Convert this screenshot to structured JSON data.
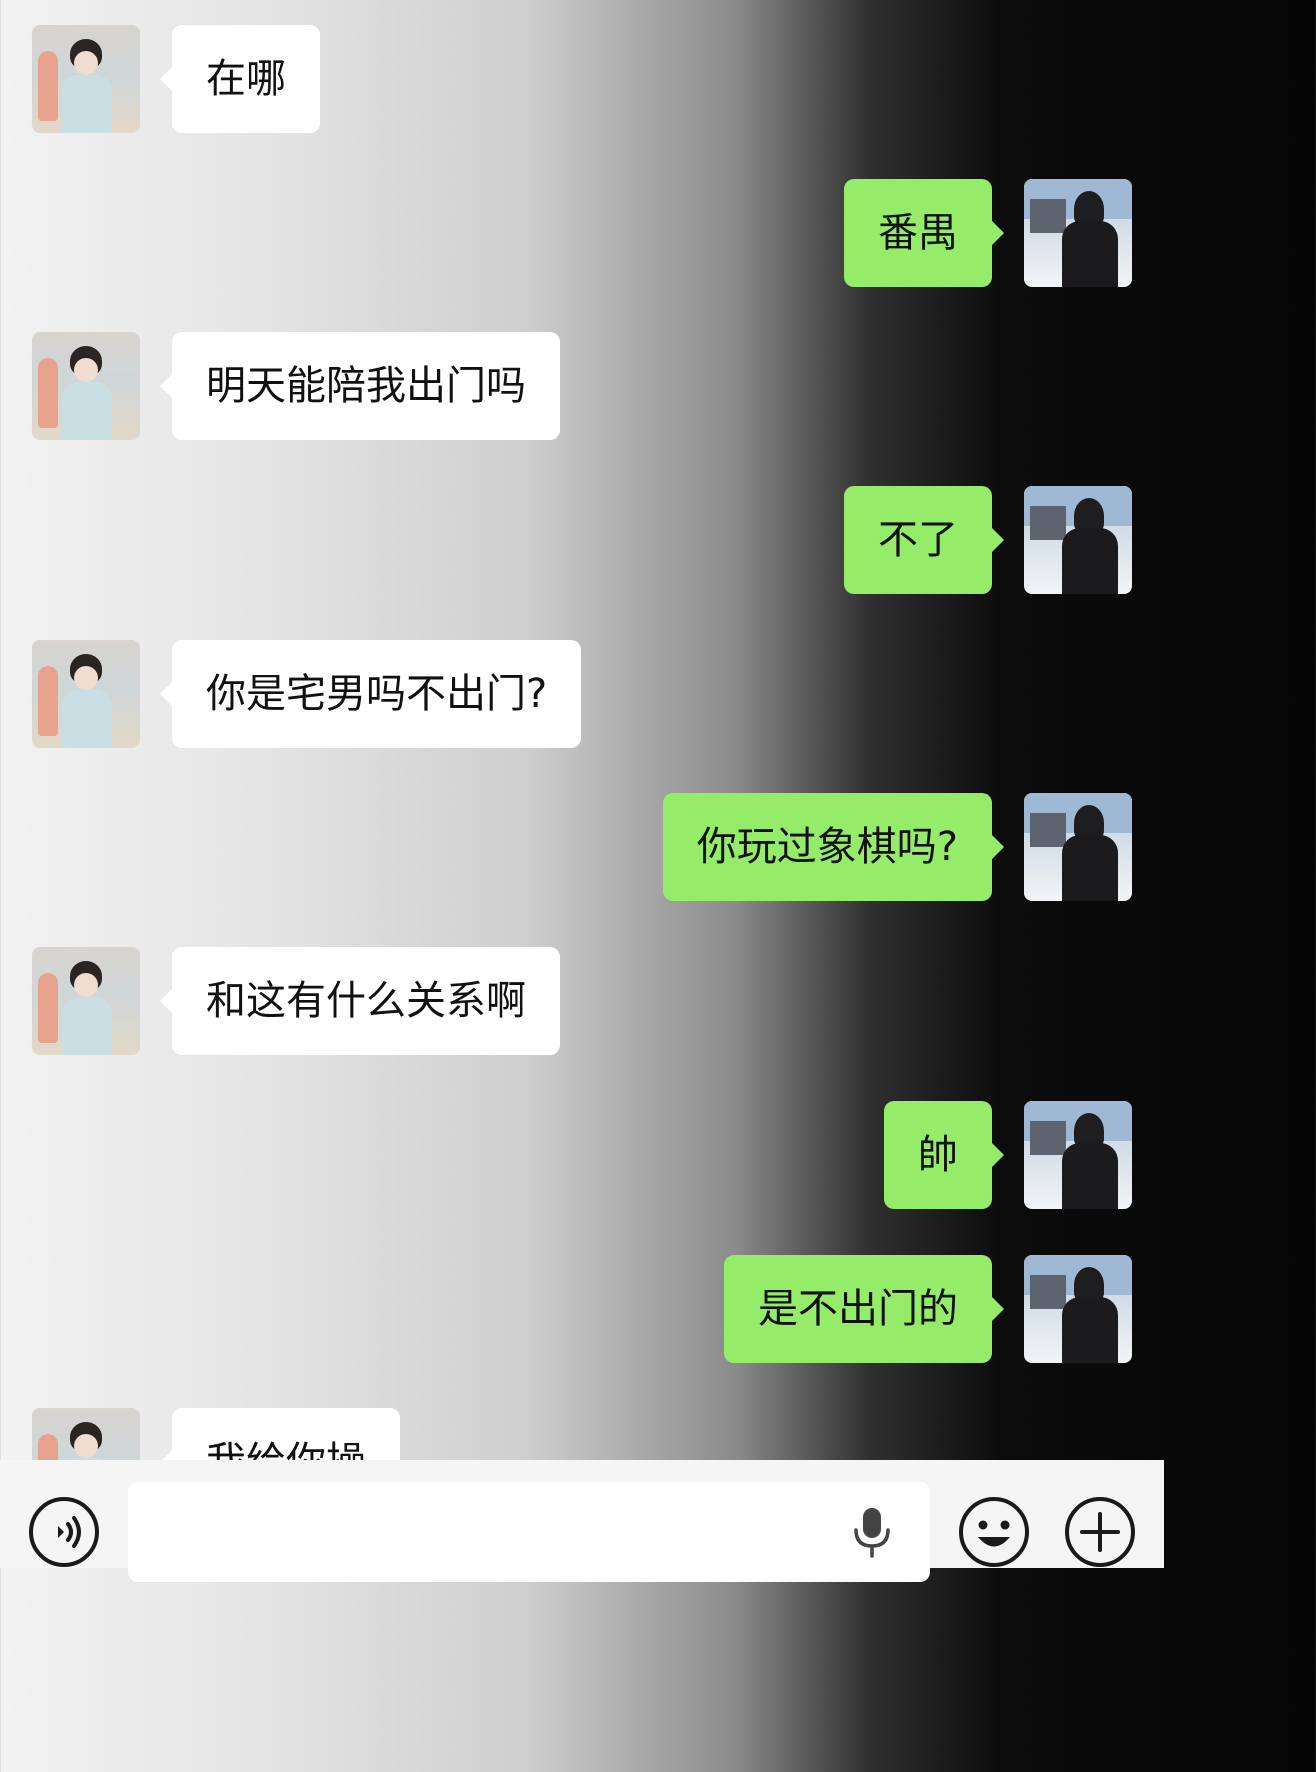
{
  "messages": [
    {
      "side": "left",
      "text": "在哪"
    },
    {
      "side": "right",
      "text": "番禺"
    },
    {
      "side": "left",
      "text": "明天能陪我出门吗"
    },
    {
      "side": "right",
      "text": "不了"
    },
    {
      "side": "left",
      "text": "你是宅男吗不出门?"
    },
    {
      "side": "right",
      "text": "你玩过象棋吗?"
    },
    {
      "side": "left",
      "text": "和这有什么关系啊"
    },
    {
      "side": "right",
      "text": "帥"
    },
    {
      "side": "right",
      "text": "是不出门的"
    },
    {
      "side": "left",
      "text": "我给你操"
    }
  ],
  "input_bar": {
    "icons": [
      "voice-mode-icon",
      "microphone-icon",
      "emoji-icon",
      "plus-icon"
    ]
  },
  "colors": {
    "bubble_self": "#95ec69",
    "bubble_other": "#ffffff",
    "input_bar": "#f5f5f5"
  }
}
